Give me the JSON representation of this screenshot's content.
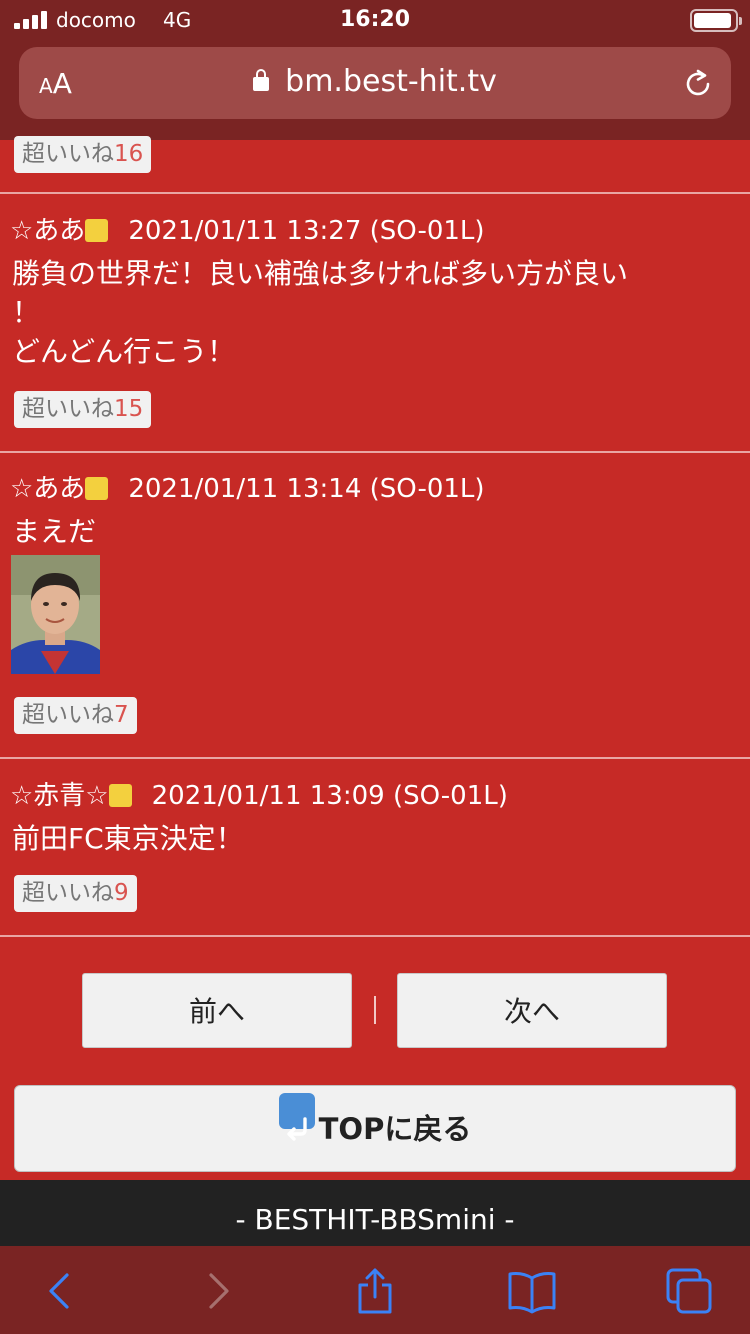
{
  "status_bar": {
    "carrier": "docomo",
    "network": "4G",
    "time": "16:20"
  },
  "url_bar": {
    "aa_label_small": "A",
    "aa_label_large": "A",
    "host": "bm.best-hit.tv"
  },
  "top_partial_like": {
    "label": "超いいね",
    "count": "16"
  },
  "posts": [
    {
      "name": "☆ああ",
      "timestamp": "2021/01/11 13:27 (SO-01L)",
      "lines": [
        "勝負の世界だ！良い補強は多ければ多い方が良い",
        "！",
        "どんどん行こう！"
      ],
      "like_label": "超いいね",
      "like_count": "15"
    },
    {
      "name": "☆ああ",
      "timestamp": "2021/01/11 13:14 (SO-01L)",
      "lines": [
        "まえだ"
      ],
      "like_label": "超いいね",
      "like_count": "7"
    },
    {
      "name": "☆赤青☆",
      "timestamp": "2021/01/11 13:09 (SO-01L)",
      "lines": [
        "前田FC東京決定！"
      ],
      "like_label": "超いいね",
      "like_count": "9"
    }
  ],
  "pagination": {
    "prev_label": "前へ",
    "next_label": "次へ",
    "separator": "|"
  },
  "top_button": {
    "label": "TOPに戻る"
  },
  "footer": {
    "text": "- BESTHIT-BBSmini -"
  },
  "colors": {
    "page_background": "#c62a26",
    "browser_chrome": "#7a2423",
    "like_count": "#d9534f",
    "square_badge": "#f3d03e"
  }
}
